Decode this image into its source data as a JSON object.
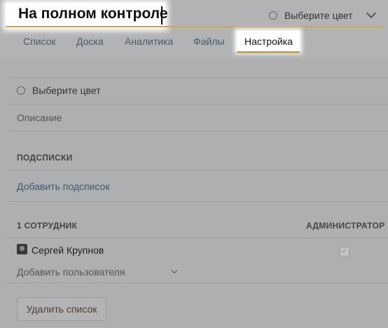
{
  "header": {
    "title": "На полном контроле",
    "color_picker_label": "Выберите цвет"
  },
  "tabs": [
    {
      "label": "Список"
    },
    {
      "label": "Доска"
    },
    {
      "label": "Аналитика"
    },
    {
      "label": "Файлы"
    },
    {
      "label": "Настройка",
      "active": true
    }
  ],
  "settings": {
    "color_label": "Выберите цвет",
    "description_placeholder": "Описание",
    "sublists_header": "ПОДСПИСКИ",
    "add_sublist": "Добавить подсписок",
    "members_header": "1 СОТРУДНИК",
    "admin_header": "АДМИНИСТРАТОР",
    "members": [
      {
        "name": "Сергей Крупнов",
        "is_admin": true
      }
    ],
    "add_user": "Добавить пользователя",
    "delete_list": "Удалить список"
  },
  "colors": {
    "accent": "#c9a54b",
    "overlay": "#aeafb1",
    "link": "#3d5a6f"
  }
}
